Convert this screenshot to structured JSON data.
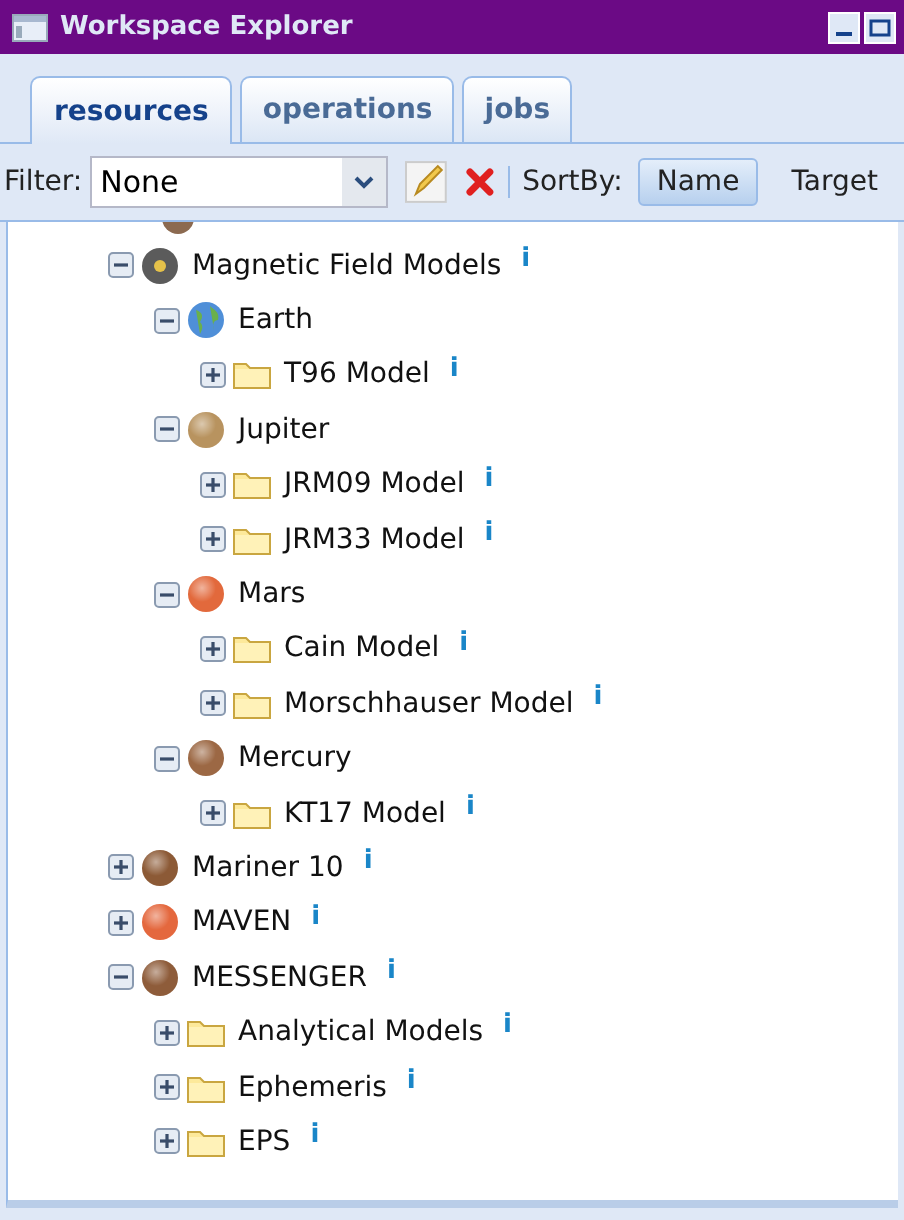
{
  "window": {
    "title": "Workspace Explorer"
  },
  "tabs": [
    {
      "label": "resources",
      "selected": true
    },
    {
      "label": "operations",
      "selected": false
    },
    {
      "label": "jobs",
      "selected": false
    }
  ],
  "toolbar": {
    "filter_label": "Filter:",
    "filter_value": "None",
    "sort_label": "SortBy:",
    "sort_options": [
      {
        "label": "Name",
        "selected": true
      },
      {
        "label": "Target",
        "selected": false
      }
    ]
  },
  "tree": [
    {
      "label": "Magnetic Field Models",
      "kind": "disc",
      "expanded": true,
      "info": "i",
      "children": [
        {
          "label": "Earth",
          "kind": "earth",
          "expanded": true,
          "children": [
            {
              "label": "T96 Model",
              "kind": "folder",
              "expanded": false,
              "info": "i"
            }
          ]
        },
        {
          "label": "Jupiter",
          "kind": "planet",
          "color": "#b8935f",
          "expanded": true,
          "children": [
            {
              "label": "JRM09 Model",
              "kind": "folder",
              "expanded": false,
              "info": "i"
            },
            {
              "label": "JRM33 Model",
              "kind": "folder",
              "expanded": false,
              "info": "i"
            }
          ]
        },
        {
          "label": "Mars",
          "kind": "planet",
          "color": "#e2693c",
          "expanded": true,
          "children": [
            {
              "label": "Cain Model",
              "kind": "folder",
              "expanded": false,
              "info": "i"
            },
            {
              "label": "Morschhauser Model",
              "kind": "folder",
              "expanded": false,
              "info": "i"
            }
          ]
        },
        {
          "label": "Mercury",
          "kind": "planet",
          "color": "#9c6844",
          "expanded": true,
          "children": [
            {
              "label": "KT17 Model",
              "kind": "folder",
              "expanded": false,
              "info": "i"
            }
          ]
        }
      ]
    },
    {
      "label": "Mariner 10",
      "kind": "planet",
      "color": "#8c5a36",
      "expanded": false,
      "info": "i"
    },
    {
      "label": "MAVEN",
      "kind": "planet",
      "color": "#e4683e",
      "expanded": false,
      "info": "i"
    },
    {
      "label": "MESSENGER",
      "kind": "planet",
      "color": "#8e5c3a",
      "expanded": true,
      "info": "i",
      "children": [
        {
          "label": "Analytical Models",
          "kind": "folder",
          "expanded": false,
          "info": "i"
        },
        {
          "label": "Ephemeris",
          "kind": "folder",
          "expanded": false,
          "info": "i"
        },
        {
          "label": "EPS",
          "kind": "folder",
          "expanded": false,
          "info": "i"
        }
      ]
    }
  ]
}
